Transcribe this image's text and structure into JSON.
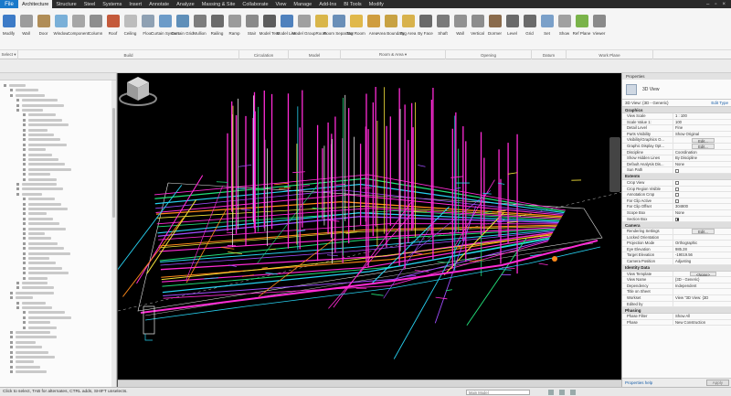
{
  "menu": {
    "file": "File",
    "tabs": [
      "Architecture",
      "Structure",
      "Steel",
      "Systems",
      "Insert",
      "Annotate",
      "Analyze",
      "Massing & Site",
      "Collaborate",
      "View",
      "Manage",
      "Add-Ins",
      "BI Tools",
      "Modify"
    ],
    "active_tab": 0
  },
  "ribbon": {
    "tools": [
      {
        "label": "Modify",
        "color": "#3d7bc7"
      },
      {
        "label": "Wall",
        "color": "#9c9c9c"
      },
      {
        "label": "Door",
        "color": "#b08d57"
      },
      {
        "label": "Window",
        "color": "#7ab0d8"
      },
      {
        "label": "Component",
        "color": "#a6a6a6"
      },
      {
        "label": "Column",
        "color": "#8e8e8e"
      },
      {
        "label": "Roof",
        "color": "#c45a3b"
      },
      {
        "label": "Ceiling",
        "color": "#bdbdbd"
      },
      {
        "label": "Floor",
        "color": "#8fa1b3"
      },
      {
        "label": "Curtain System",
        "color": "#6c9bc8"
      },
      {
        "label": "Curtain Grid",
        "color": "#5f8fb9"
      },
      {
        "label": "Mullion",
        "color": "#7d7d7d"
      },
      {
        "label": "Railing",
        "color": "#6b6b6b"
      },
      {
        "label": "Ramp",
        "color": "#9b9b9b"
      },
      {
        "label": "Stair",
        "color": "#8a8a8a"
      },
      {
        "label": "Model Text",
        "color": "#5d5d5d"
      },
      {
        "label": "Model Line",
        "color": "#4f81bd"
      },
      {
        "label": "Model Group",
        "color": "#a0a0a0"
      },
      {
        "label": "Room",
        "color": "#d9b64a"
      },
      {
        "label": "Room Separator",
        "color": "#6a8fb8"
      },
      {
        "label": "Tag Room",
        "color": "#e0b84a"
      },
      {
        "label": "Area",
        "color": "#cf9d3f"
      },
      {
        "label": "Area Boundary",
        "color": "#c8a243"
      },
      {
        "label": "Tag Area",
        "color": "#d8b24c"
      },
      {
        "label": "By Face",
        "color": "#6a6a6a"
      },
      {
        "label": "Shaft",
        "color": "#7a7a7a"
      },
      {
        "label": "Wall",
        "color": "#929292"
      },
      {
        "label": "Vertical",
        "color": "#8d8d8d"
      },
      {
        "label": "Dormer",
        "color": "#8a6b4c"
      },
      {
        "label": "Level",
        "color": "#6a6a6a"
      },
      {
        "label": "Grid",
        "color": "#6a6a6a"
      },
      {
        "label": "Set",
        "color": "#7aa0c9"
      },
      {
        "label": "Show",
        "color": "#a0a0a0"
      },
      {
        "label": "Ref Plane",
        "color": "#7ab34a"
      },
      {
        "label": "Viewer",
        "color": "#8a8a8a"
      }
    ],
    "groups": [
      {
        "label": "Select ▾",
        "width": 20
      },
      {
        "label": "Build",
        "width": 242
      },
      {
        "label": "Circulation",
        "width": 54
      },
      {
        "label": "Model",
        "width": 57
      },
      {
        "label": "Room & Area ▾",
        "width": 115
      },
      {
        "label": "Opening",
        "width": 94
      },
      {
        "label": "Datum",
        "width": 38
      },
      {
        "label": "Work Plane",
        "width": 95
      }
    ]
  },
  "properties": {
    "title": "Properties",
    "type_name": "3D View",
    "filter_label": "3D View: {3D - Generic}",
    "edit_type": "Edit Type",
    "sections": [
      {
        "name": "Graphics",
        "rows": [
          {
            "k": "View Scale",
            "v": "1 : 100"
          },
          {
            "k": "Scale Value 1:",
            "v": "100"
          },
          {
            "k": "Detail Level",
            "v": "Fine"
          },
          {
            "k": "Parts Visibility",
            "v": "Show Original"
          },
          {
            "k": "Visibility/Graphics O...",
            "v": "Edit...",
            "btn": true
          },
          {
            "k": "Graphic Display Opt...",
            "v": "Edit...",
            "btn": true
          },
          {
            "k": "Discipline",
            "v": "Coordination"
          },
          {
            "k": "Show Hidden Lines",
            "v": "By Discipline"
          },
          {
            "k": "Default Analysis Dis...",
            "v": "None"
          },
          {
            "k": "Sun Path",
            "v": "",
            "chk": false
          }
        ]
      },
      {
        "name": "Extents",
        "rows": [
          {
            "k": "Crop View",
            "v": "",
            "chk": false
          },
          {
            "k": "Crop Region Visible",
            "v": "",
            "chk": false
          },
          {
            "k": "Annotation Crop",
            "v": "",
            "chk": false
          },
          {
            "k": "Far Clip Active",
            "v": "",
            "chk": false
          },
          {
            "k": "Far Clip Offset",
            "v": "304800"
          },
          {
            "k": "Scope Box",
            "v": "None"
          },
          {
            "k": "Section Box",
            "v": "",
            "chk": true
          }
        ]
      },
      {
        "name": "Camera",
        "rows": [
          {
            "k": "Rendering Settings",
            "v": "Edit...",
            "btn": true
          },
          {
            "k": "Locked Orientation",
            "v": ""
          },
          {
            "k": "Projection Mode",
            "v": "Orthographic"
          },
          {
            "k": "Eye Elevation",
            "v": "985.28"
          },
          {
            "k": "Target Elevation",
            "v": "-19019.56"
          },
          {
            "k": "Camera Position",
            "v": "Adjusting"
          }
        ]
      },
      {
        "name": "Identity Data",
        "rows": [
          {
            "k": "View Template",
            "v": "<None>",
            "btn": true
          },
          {
            "k": "View Name",
            "v": "{3D - Generic}"
          },
          {
            "k": "Dependency",
            "v": "Independent"
          },
          {
            "k": "Title on Sheet",
            "v": ""
          },
          {
            "k": "Workset",
            "v": "View \"3D View: {3D"
          },
          {
            "k": "Edited by",
            "v": ""
          }
        ]
      },
      {
        "name": "Phasing",
        "rows": [
          {
            "k": "Phase Filter",
            "v": "Show All"
          },
          {
            "k": "Phase",
            "v": "New Construction"
          }
        ]
      }
    ],
    "help_link": "Properties help",
    "apply": "Apply"
  },
  "status": {
    "text": "Click to select, TAB for alternates, CTRL adds, SHIFT unselects.",
    "main_model": "Main Model"
  },
  "colors": {
    "accent": "#1979ca",
    "magenta": "#ff2bd6",
    "green": "#22e07a",
    "cyan": "#27d0f0",
    "yellow": "#f4e23a",
    "orange": "#ff8a1a",
    "white": "#e8e8e8",
    "purple": "#a04dff"
  }
}
